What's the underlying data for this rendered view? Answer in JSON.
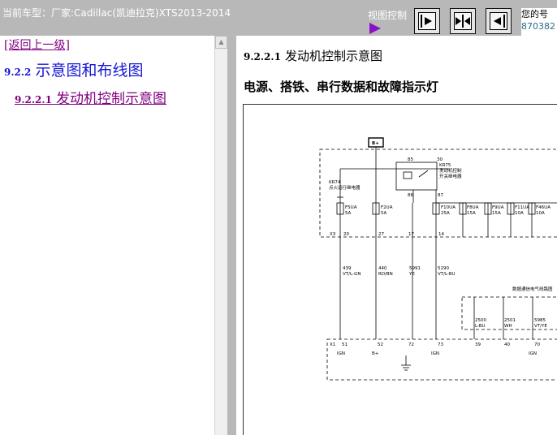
{
  "header": {
    "vehicle_label": "当前车型：厂家:Cadillac(凯迪拉克)XTS2013-2014",
    "view_control_label": "视图控制",
    "info_line1": "您的号",
    "info_line2": "870382"
  },
  "nav": {
    "back_label": "[返回上一级]",
    "section_number": "9.2.2",
    "section_title": "示意图和布线图",
    "sub_number": "9.2.2.1",
    "sub_title": "发动机控制示意图"
  },
  "content": {
    "title_number": "9.2.2.1",
    "title_text": "发动机控制示意图",
    "subtitle": "电源、搭铁、串行数据和故障指示灯"
  },
  "diagram": {
    "bplus": "B+",
    "relay_pin_85": "85",
    "relay_pin_30": "30",
    "relay_pin_86": "86",
    "relay_pin_87": "87",
    "relay_name": "KR75",
    "relay_desc1": "发动机控制",
    "relay_desc2": "开关继电器",
    "kr74_name": "KR74",
    "kr74_desc": "点火运行继电器",
    "connector_x3": "X3",
    "connector_x1": "X1",
    "data_bus_label": "数据通信电气线路图",
    "fuses": [
      {
        "name": "F5UA",
        "amp": "5A"
      },
      {
        "name": "F2UA",
        "amp": "5A"
      },
      {
        "name": "F10UA",
        "amp": "25A"
      },
      {
        "name": "F8UA",
        "amp": "15A"
      },
      {
        "name": "F9UA",
        "amp": "15A"
      },
      {
        "name": "F11UA",
        "amp": "10A"
      },
      {
        "name": "F46UA",
        "amp": "10A"
      }
    ],
    "x3_pins": [
      "20",
      "27",
      "17",
      "14"
    ],
    "wires": [
      {
        "circuit": "439",
        "color": "VT/L-GN"
      },
      {
        "circuit": "440",
        "color": "RD/BN"
      },
      {
        "circuit": "5991",
        "color": "YE"
      },
      {
        "circuit": "5290",
        "color": "VT/L-BU"
      },
      {
        "circuit": "2500",
        "color": "L-BU"
      },
      {
        "circuit": "2501",
        "color": "WH"
      },
      {
        "circuit": "5985",
        "color": "VT/YE"
      }
    ],
    "x1_pins": [
      "51",
      "52",
      "72",
      "73",
      "39",
      "40",
      "70"
    ],
    "x1_labels": [
      "IGN",
      "B+",
      "IGN",
      "IGN"
    ]
  }
}
